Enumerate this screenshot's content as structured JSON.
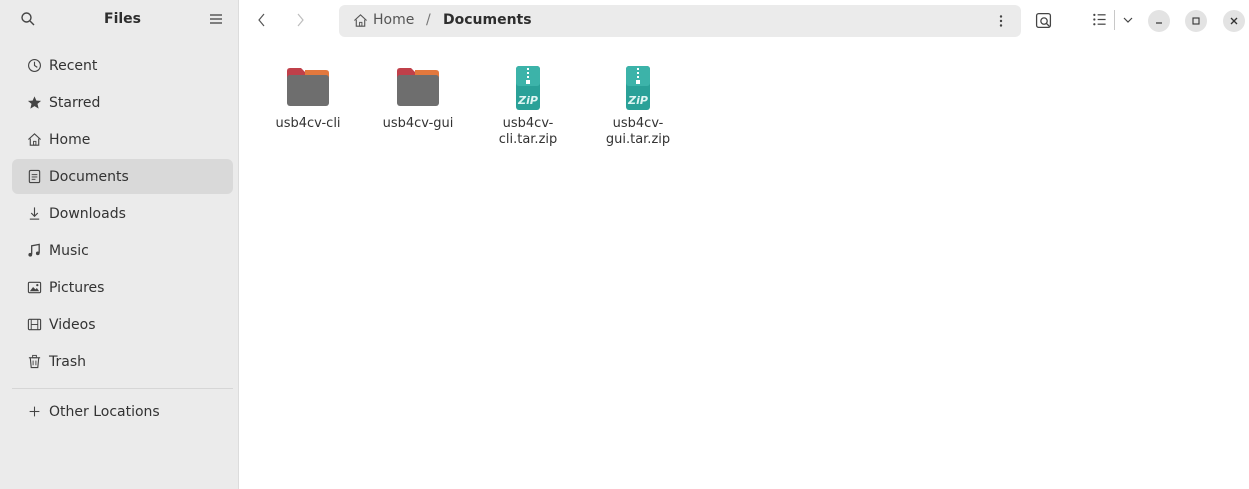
{
  "sidebar": {
    "title": "Files",
    "places": [
      {
        "label": "Recent",
        "icon": "clock-icon"
      },
      {
        "label": "Starred",
        "icon": "star-icon"
      },
      {
        "label": "Home",
        "icon": "home-icon"
      },
      {
        "label": "Documents",
        "icon": "document-icon",
        "active": true
      },
      {
        "label": "Downloads",
        "icon": "download-icon"
      },
      {
        "label": "Music",
        "icon": "music-icon"
      },
      {
        "label": "Pictures",
        "icon": "picture-icon"
      },
      {
        "label": "Videos",
        "icon": "video-icon"
      },
      {
        "label": "Trash",
        "icon": "trash-icon"
      }
    ],
    "other_locations": "Other Locations"
  },
  "pathbar": {
    "home": "Home",
    "separator": "/",
    "current": "Documents"
  },
  "files": [
    {
      "name": "usb4cv-cli",
      "type": "folder"
    },
    {
      "name": "usb4cv-gui",
      "type": "folder"
    },
    {
      "name": "usb4cv-\ncli.tar.zip",
      "type": "zip"
    },
    {
      "name": "usb4cv-\ngui.tar.zip",
      "type": "zip"
    }
  ],
  "zip_badge": "ZiP",
  "colors": {
    "sidebar_bg": "#ebebeb",
    "selected_bg": "#d9d9d9",
    "folder_tab": "#c0404a",
    "folder_body": "#6e6e6e",
    "zip_teal": "#2aa198"
  }
}
